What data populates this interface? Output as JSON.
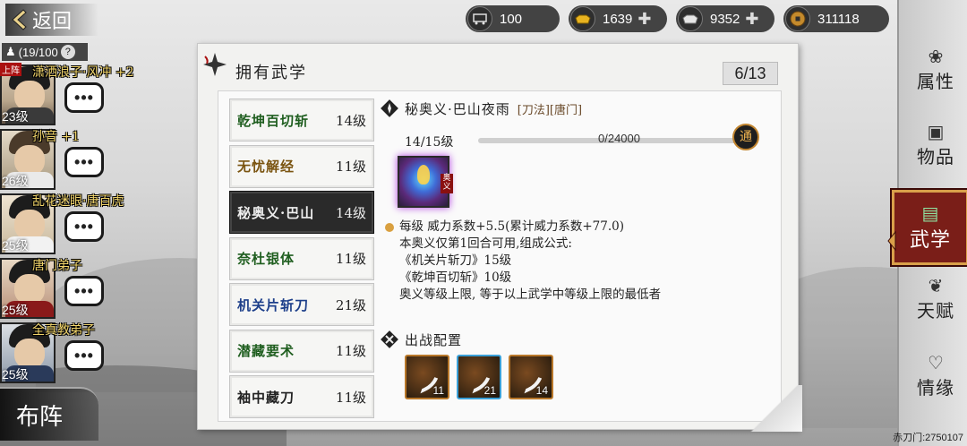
{
  "nav": {
    "back_label": "返回"
  },
  "currencies": [
    {
      "icon": "cart-icon",
      "value": "100"
    },
    {
      "icon": "gold-ingot-icon",
      "value": "1639"
    },
    {
      "icon": "silver-ingot-icon",
      "value": "9352"
    },
    {
      "icon": "copper-coin-icon",
      "value": "311118"
    }
  ],
  "team": {
    "count": "(19/100",
    "help": "?"
  },
  "roster": [
    {
      "name": "潇洒浪子·风冲 +2",
      "level": "23级",
      "bubble": "•••",
      "tag": "上阵"
    },
    {
      "name": "孙音 +1",
      "level": "26级",
      "bubble": "•••"
    },
    {
      "name": "乱花迷眼·唐百虎",
      "level": "25级",
      "bubble": "•••"
    },
    {
      "name": "唐门弟子",
      "level": "25级",
      "bubble": "•••"
    },
    {
      "name": "全真教弟子",
      "level": "25级",
      "bubble": "•••"
    }
  ],
  "formation_label": "布阵",
  "panel": {
    "title": "拥有武学",
    "count": "6/13"
  },
  "skills": [
    {
      "name": "乾坤百切斩",
      "level": "14级",
      "color": "#1f5e1f",
      "selected": false
    },
    {
      "name": "无忧解经",
      "level": "11级",
      "color": "#7a5410",
      "selected": false
    },
    {
      "name": "秘奥义·巴山",
      "level": "14级",
      "color": "#eeeeee",
      "selected": true
    },
    {
      "name": "奈杜银体",
      "level": "11级",
      "color": "#1f5e1f",
      "selected": false
    },
    {
      "name": "机关片斩刀",
      "level": "21级",
      "color": "#1d3f8a",
      "selected": false
    },
    {
      "name": "潜藏要术",
      "level": "11级",
      "color": "#1f5e1f",
      "selected": false
    },
    {
      "name": "袖中藏刀",
      "level": "11级",
      "color": "#1f1f1f",
      "selected": false
    }
  ],
  "detail": {
    "title": "秘奥义·巴山夜雨",
    "tags": "[刀法][唐门]",
    "level_text": "14/15级",
    "xp_text": "0/24000",
    "tong_label": "通",
    "icon_seal": "奥义",
    "lines": [
      "每级  威力系数+5.5(累计威力系数+77.0)",
      "本奥义仅第1回合可用,组成公式:",
      "《机关片斩刀》15级",
      "《乾坤百切斩》10级",
      "奥义等级上限, 等于以上武学中等级上限的最低者"
    ],
    "battle_label": "出战配置",
    "weapons": [
      {
        "level": "11",
        "frame": "gold"
      },
      {
        "level": "21",
        "frame": "blue"
      },
      {
        "level": "14",
        "frame": "gold"
      }
    ]
  },
  "side_nav": [
    {
      "label": "属性",
      "icon": "attributes-icon"
    },
    {
      "label": "物品",
      "icon": "items-icon"
    },
    {
      "label": "武学",
      "icon": "martial-arts-icon",
      "active": true
    },
    {
      "label": "天赋",
      "icon": "talent-icon"
    },
    {
      "label": "情缘",
      "icon": "relationship-icon"
    }
  ],
  "footer": "赤刀门:2750107"
}
